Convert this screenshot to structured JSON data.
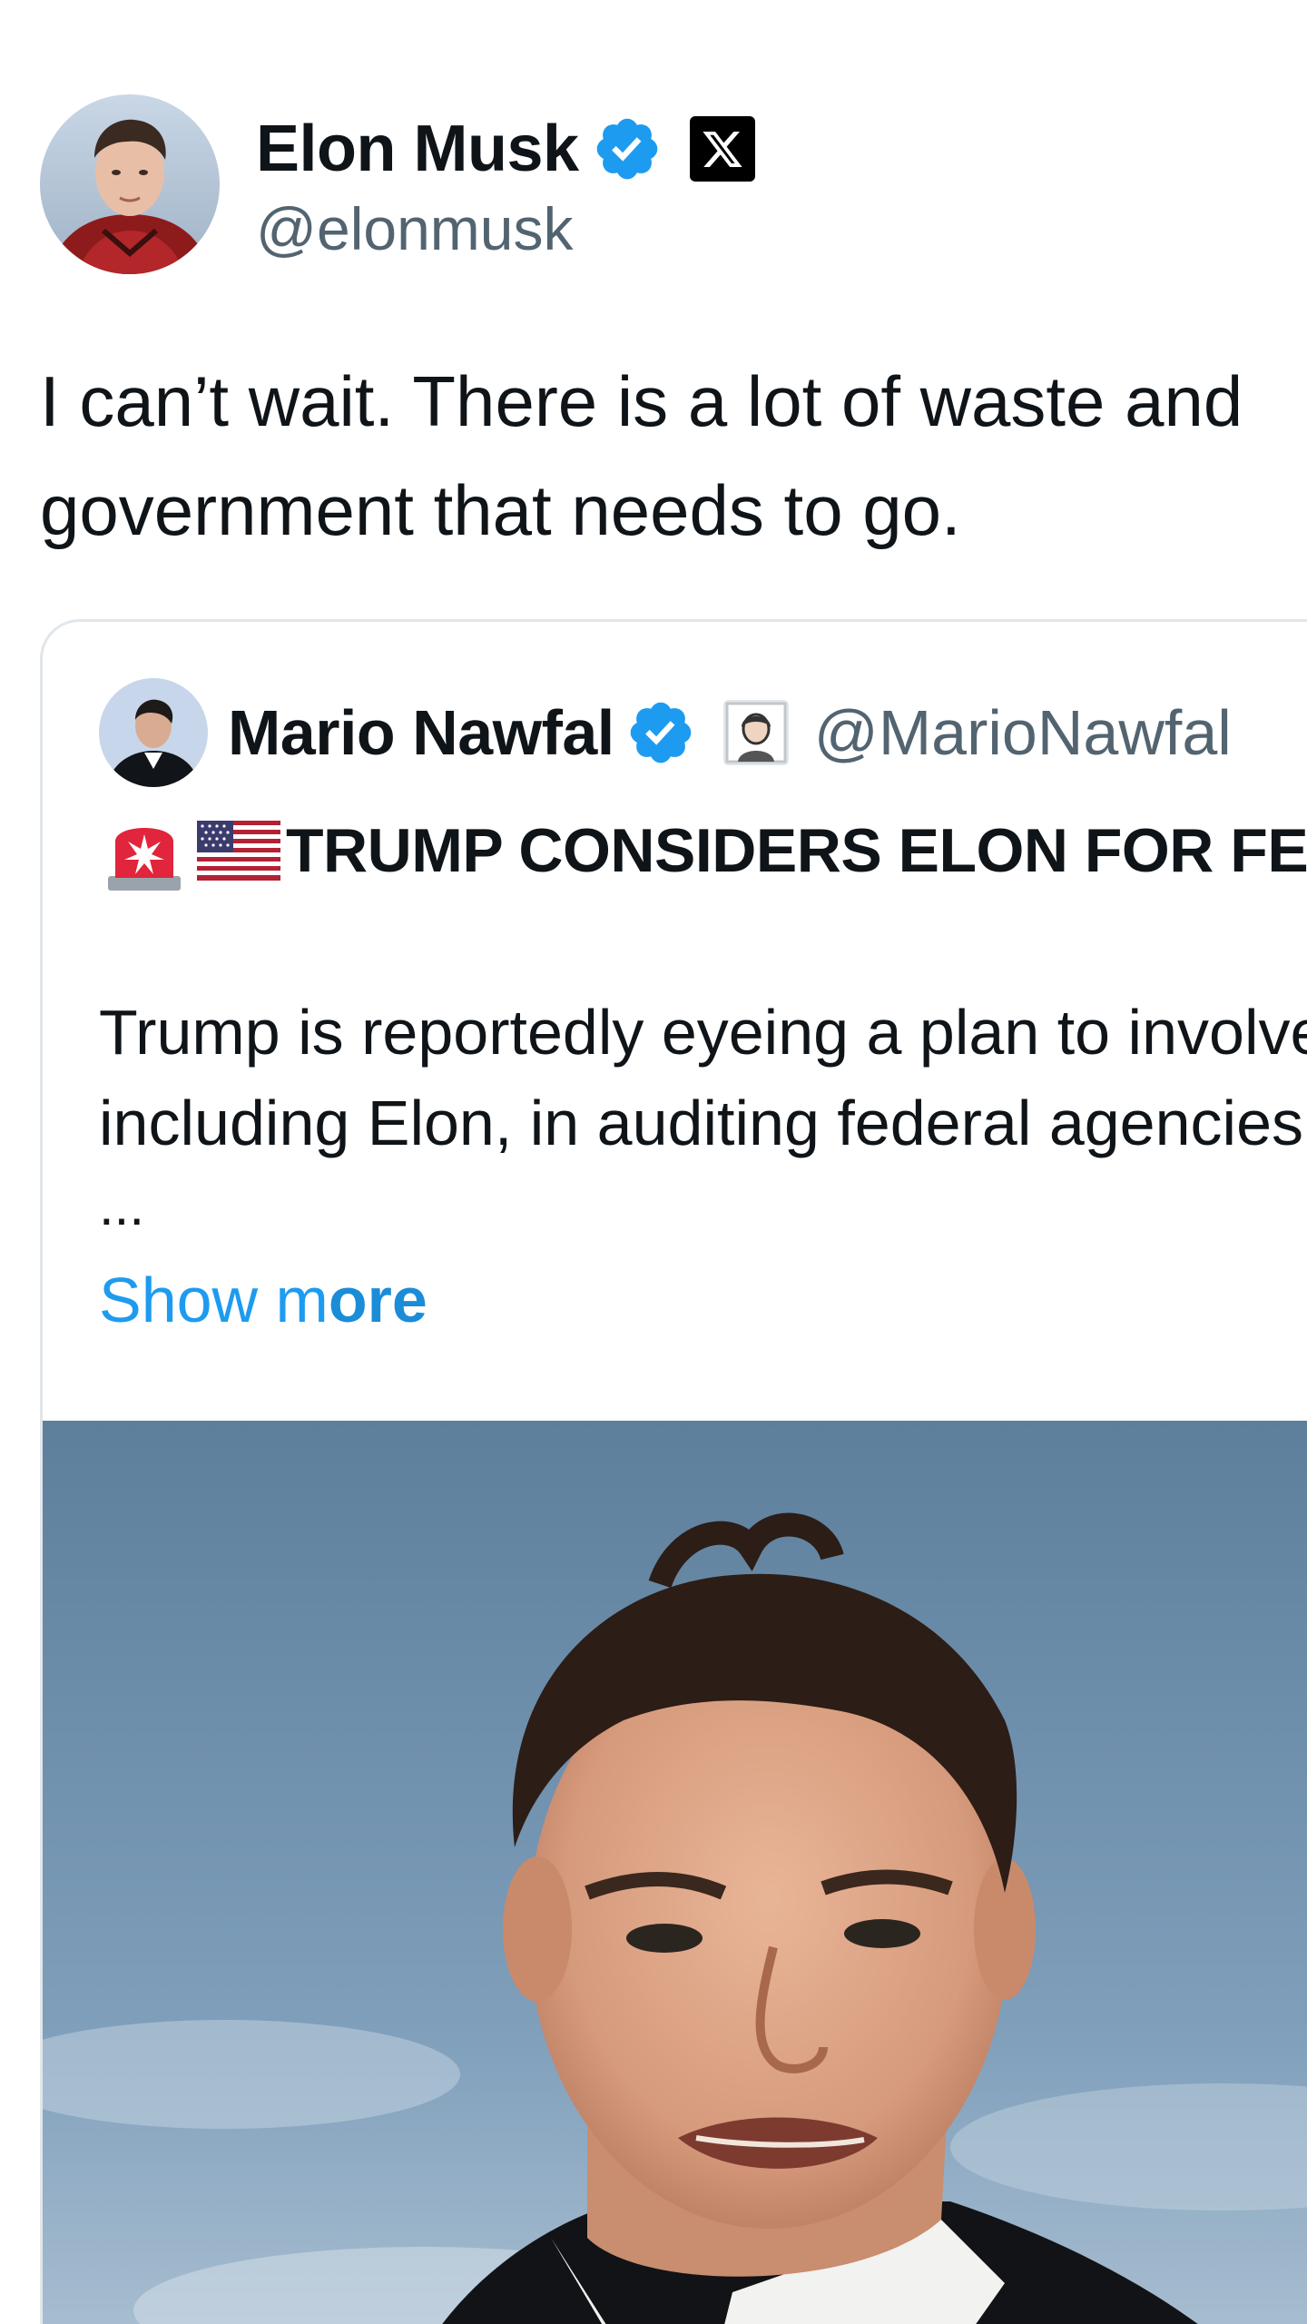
{
  "author": {
    "display_name": "Elon Musk",
    "handle": "@elonmusk",
    "verified": true,
    "affiliation": "X",
    "avatar_icon": "avatar-photo"
  },
  "tweet": {
    "text_line_1": "I can’t wait. There is a lot of waste and",
    "text_line_2": "government that needs to go."
  },
  "quoted": {
    "display_name": "Mario Nawfal",
    "handle": "@MarioNawfal",
    "verified": true,
    "headline_icons": [
      "siren-icon",
      "us-flag-icon"
    ],
    "headline": "TRUMP CONSIDERS ELON FOR FEDERAL",
    "body_line_1": "Trump is reportedly eyeing a plan to involve",
    "body_line_2": "including Elon, in auditing federal agencies",
    "ellipsis": "...",
    "show_more_a": "Show m",
    "show_more_b": "ore",
    "media_icon": "photo-of-person"
  },
  "colors": {
    "verified_blue": "#1d9bf0",
    "link_blue": "#1d9bf0",
    "secondary_text": "#536471",
    "primary_text": "#0f1419",
    "border": "#e1e6ea"
  }
}
